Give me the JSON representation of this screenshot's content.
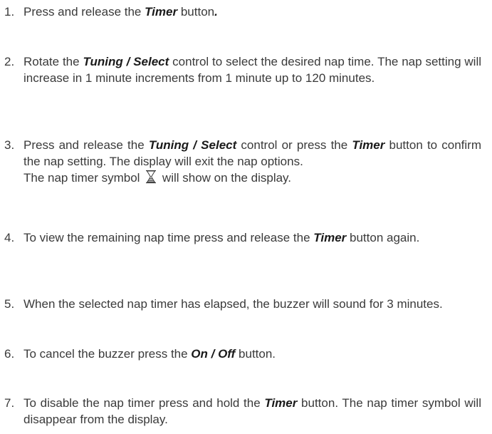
{
  "steps": [
    {
      "num": "1.",
      "a": "Press and release the ",
      "b1": "Timer",
      "c": " button",
      "c_period": "."
    },
    {
      "num": "2.",
      "a": "Rotate the ",
      "b1": "Tuning / Select",
      "c": " control to select the desired nap time. The nap setting will increase in 1 minute increments from 1 minute up to 120 minutes."
    },
    {
      "num": "3.",
      "a": "Press and release the ",
      "b1": "Tuning / Select",
      "c": " control or press the ",
      "b2": "Timer",
      "d": " button to confirm the nap setting. The display will exit the nap options.",
      "e": "The nap timer symbol ",
      "f": " will show on the display."
    },
    {
      "num": "4.",
      "a": "To view the remaining nap time press and release the ",
      "b1": "Timer",
      "c": " button again."
    },
    {
      "num": "5.",
      "a": "When the selected nap timer has elapsed, the buzzer will sound for 3 minutes."
    },
    {
      "num": "6.",
      "a": "To cancel the buzzer press the ",
      "b1": "On / Off",
      "c": " button."
    },
    {
      "num": "7.",
      "a": "To disable the nap timer press and hold the ",
      "b1": "Timer",
      "c": " button. The nap timer symbol will disappear from the display."
    }
  ],
  "icons": {
    "nap_timer": "hourglass-icon"
  }
}
